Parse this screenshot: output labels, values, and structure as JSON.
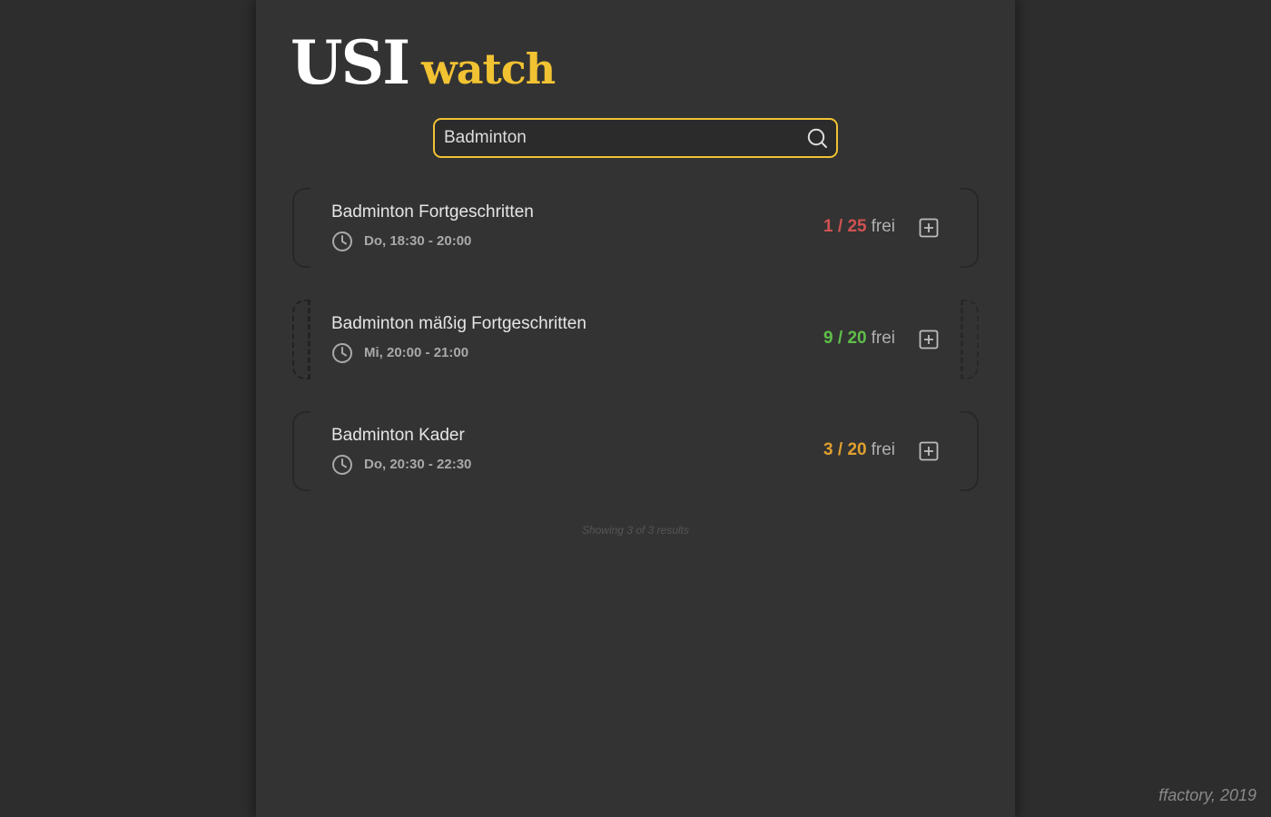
{
  "brand": {
    "primary": "USI",
    "secondary": "watch",
    "accent_color": "#f1c232"
  },
  "search": {
    "value": "Badminton",
    "placeholder": "",
    "icon": "search-icon"
  },
  "courses": [
    {
      "name": "Badminton Fortgeschritten",
      "time": "Do, 18:30 - 20:00",
      "count": "1 / 25",
      "label": "frei",
      "status_color": "#d05252"
    },
    {
      "name": "Badminton mäßig Fortgeschritten",
      "time": "Mi, 20:00 - 21:00",
      "count": "9 / 20",
      "label": "frei",
      "status_color": "#5fbf4a"
    },
    {
      "name": "Badminton Kader",
      "time": "Do, 20:30 - 22:30",
      "count": "3 / 20",
      "label": "frei",
      "status_color": "#e0a030"
    }
  ],
  "results_summary": "Showing 3 of 3 results",
  "footer": {
    "credit": "ffactory, 2019"
  }
}
